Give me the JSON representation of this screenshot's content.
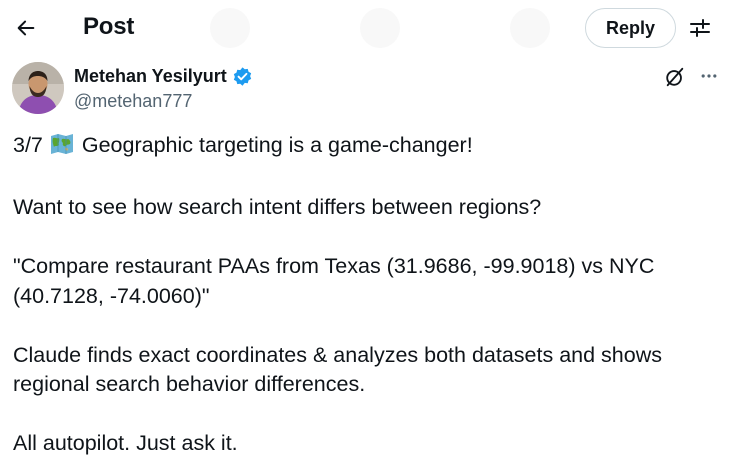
{
  "header": {
    "title": "Post",
    "back_icon": "arrow-left-icon",
    "reply_label": "Reply",
    "filter_icon": "sliders-icon"
  },
  "author": {
    "name": "Metehan Yesilyurt",
    "handle": "@metehan777",
    "verified": true,
    "verified_color": "#1d9bf0",
    "grok_icon": "grok-icon",
    "more_icon": "more-horizontal-icon"
  },
  "post": {
    "line1_prefix": "3/7",
    "line1_emoji": "world-map-icon",
    "line1_text": "Geographic targeting is a game-changer!",
    "line2": "Want to see how search intent differs between regions?",
    "line3": "\"Compare restaurant PAAs from Texas (31.9686, -99.9018) vs NYC (40.7128, -74.0060)\"",
    "line4": "Claude finds exact coordinates & analyzes both datasets and shows regional search behavior differences.",
    "line5": "All autopilot. Just ask it."
  },
  "colors": {
    "text": "#0f1419",
    "secondary": "#536471",
    "border": "#cfd9de"
  }
}
